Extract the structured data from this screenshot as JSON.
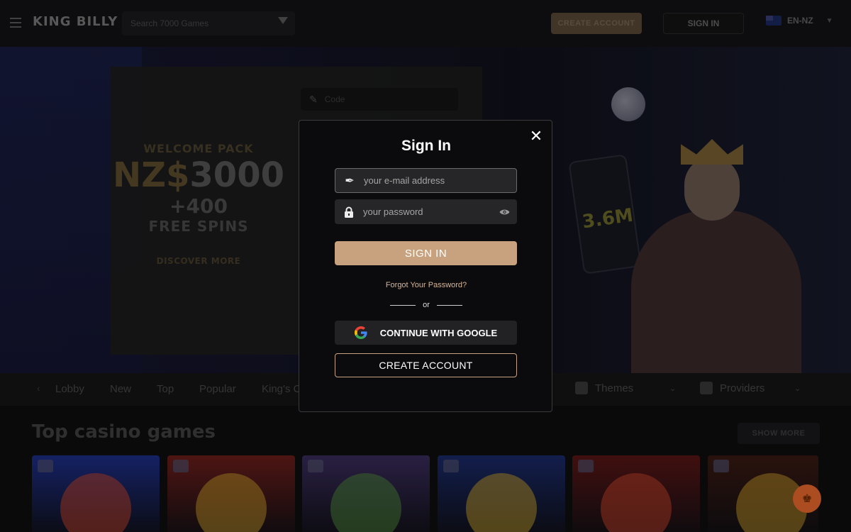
{
  "header": {
    "logo_text": "KING BILLY",
    "search_placeholder": "Search 7000 Games",
    "create_account": "CREATE ACCOUNT",
    "sign_in": "SIGN IN",
    "language": "EN-NZ"
  },
  "hero": {
    "promo_code_placeholder": "Code",
    "welcome_label": "WELCOME PACK",
    "currency": "NZ$",
    "amount": "3000",
    "spins": "+400",
    "free_spins": "FREE SPINS",
    "more_info": "DISCOVER MORE",
    "phone_amount": "3.6M"
  },
  "categories": {
    "items": [
      "Lobby",
      "New",
      "Top",
      "Popular",
      "King's C"
    ],
    "themes": "Themes",
    "providers": "Providers"
  },
  "games": {
    "title": "Top casino games",
    "show_more": "SHOW MORE",
    "tile_colors": [
      "#1d2f8a",
      "#6b1e1a",
      "#3a2c5c",
      "#1a2a6a",
      "#5a1616",
      "#3a1a12"
    ]
  },
  "modal": {
    "title": "Sign In",
    "email_placeholder": "your e-mail address",
    "password_placeholder": "your password",
    "sign_in_button": "SIGN IN",
    "forgot_password": "Forgot Your Password?",
    "or": "or",
    "google_button": "CONTINUE WITH GOOGLE",
    "create_account_button": "CREATE ACCOUNT",
    "close_icon": "close-icon",
    "accent_color": "#c8a27f"
  }
}
